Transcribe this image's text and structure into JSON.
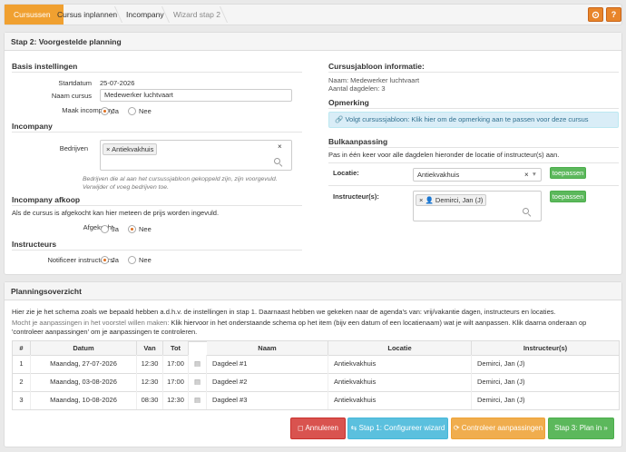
{
  "breadcrumb": {
    "items": [
      "Cursussen",
      "Cursus inplannen",
      "Incompany",
      "Wizard stap 2"
    ],
    "active": "Cursussen"
  },
  "top_buttons": {
    "settings_icon": "gear-icon",
    "help_label": "?"
  },
  "step2": {
    "title": "Stap 2: Voorgestelde planning",
    "basis": {
      "title": "Basis instellingen",
      "startdatum_label": "Startdatum",
      "startdatum_value": "25-07-2026",
      "naam_label": "Naam cursus",
      "naam_value": "Medewerker luchtvaart",
      "incompany_label": "Maak incompany",
      "ja": "Ja",
      "nee": "Nee",
      "selected": "Ja"
    },
    "incompany": {
      "title": "Incompany",
      "bedrijven_label": "Bedrijven",
      "tag": "Antiekvakhuis",
      "tag_x": "×",
      "clear_x": "×",
      "hint": "Bedrijven die al aan het cursussjabloon gekoppeld zijn, zijn voorgevuld. Verwijder of voeg bedrijven toe."
    },
    "afkoop": {
      "title": "Incompany afkoop",
      "desc": "Als de cursus is afgekocht kan hier meteen de prijs worden ingevuld.",
      "label": "Afgekocht",
      "ja": "Ja",
      "nee": "Nee",
      "selected": "Nee"
    },
    "instructeurs": {
      "title": "Instructeurs",
      "label": "Notificeer instructeurs",
      "ja": "Ja",
      "nee": "Nee",
      "selected": "Ja"
    },
    "sjabloon": {
      "title": "Cursusjabloon informatie:",
      "naam_line": "Naam: Medewerker luchtvaart",
      "dagdelen_line": "Aantal dagdelen: 3"
    },
    "opmerking": {
      "title": "Opmerking",
      "info": "Volgt cursussjabloon: Klik hier om de opmerking aan te passen voor deze cursus"
    },
    "bulk": {
      "title": "Bulkaanpassing",
      "desc": "Pas in één keer voor alle dagdelen hieronder de locatie of instructeur(s) aan.",
      "locatie_label": "Locatie:",
      "locatie_value": "Antiekvakhuis",
      "locatie_clear": "×",
      "locatie_caret": "▾",
      "instructeur_label": "Instructeur(s):",
      "instructeur_tag": "Demirci, Jan (J)",
      "tag_x": "×",
      "apply_label": "toepassen"
    }
  },
  "planning": {
    "title": "Planningsoverzicht",
    "p1": "Hier zie je het schema zoals we bepaald hebben a.d.h.v. de instellingen in stap 1. Daarnaast hebben we gekeken naar de agenda's van: vrij/vakantie dagen, instructeurs en locaties.",
    "p2_lead": "Mocht je aanpassingen in het voorstel willen maken:",
    "p2_rest": " Klik hiervoor in het onderstaande schema op het item (bijv een datum of een locatienaam) wat je wilt aanpassen. Klik daarna onderaan op 'controleer aanpassingen' om je aanpassingen te controleren.",
    "columns": [
      "#",
      "Datum",
      "Van",
      "Tot",
      "",
      "Naam",
      "Locatie",
      "Instructeur(s)"
    ],
    "rows": [
      {
        "n": "1",
        "datum": "Maandag, 27-07-2026",
        "van": "12:30",
        "tot": "17:00",
        "naam": "Dagdeel #1",
        "locatie": "Antiekvakhuis",
        "instructeur": "Demirci, Jan (J)"
      },
      {
        "n": "2",
        "datum": "Maandag, 03-08-2026",
        "van": "12:30",
        "tot": "17:00",
        "naam": "Dagdeel #2",
        "locatie": "Antiekvakhuis",
        "instructeur": "Demirci, Jan (J)"
      },
      {
        "n": "3",
        "datum": "Maandag, 10-08-2026",
        "van": "08:30",
        "tot": "12:30",
        "naam": "Dagdeel #3",
        "locatie": "Antiekvakhuis",
        "instructeur": "Demirci, Jan (J)"
      }
    ],
    "buttons": {
      "annuleren": "Annuleren",
      "stap1": "Stap 1: Configureer wizard",
      "controleer": "Controleer aanpassingen",
      "stap3": "Stap 3: Plan in"
    }
  },
  "colors": {
    "accent": "#f0a030",
    "danger": "#d9534f",
    "info": "#5bc0de",
    "warning": "#f0ad4e",
    "success": "#5cb85c"
  }
}
